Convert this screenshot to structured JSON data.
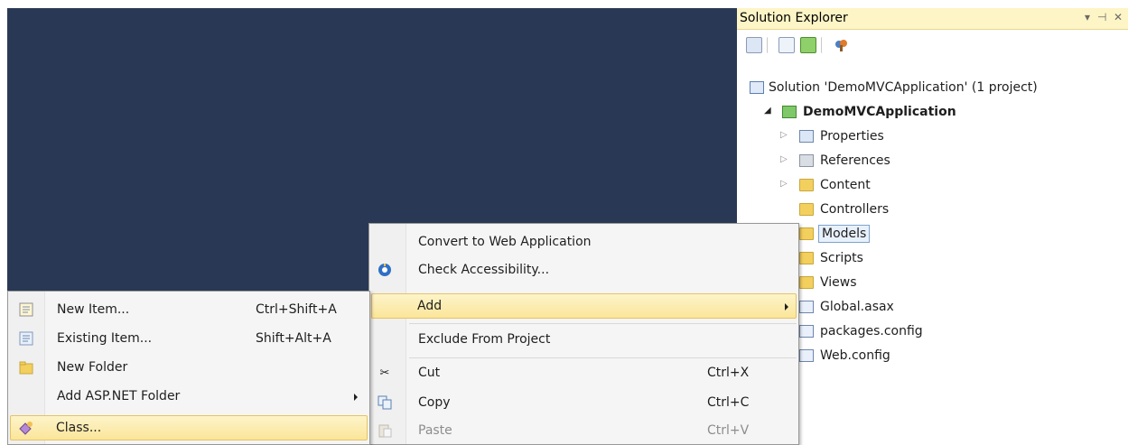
{
  "solution_explorer": {
    "title": "Solution Explorer",
    "controls": {
      "dropdown": "▾",
      "pin": "⊣",
      "close": "✕"
    },
    "tree": {
      "solution": "Solution 'DemoMVCApplication' (1 project)",
      "project": "DemoMVCApplication",
      "items": [
        "Properties",
        "References",
        "Content",
        "Controllers",
        "Models",
        "Scripts",
        "Views",
        "Global.asax",
        "packages.config",
        "Web.config"
      ]
    }
  },
  "context_menu": {
    "items": [
      {
        "label": "Convert to Web Application",
        "shortcut": ""
      },
      {
        "label": "Check Accessibility...",
        "shortcut": ""
      },
      {
        "label": "Add",
        "shortcut": ""
      },
      {
        "label": "Exclude From Project",
        "shortcut": ""
      },
      {
        "label": "Cut",
        "shortcut": "Ctrl+X"
      },
      {
        "label": "Copy",
        "shortcut": "Ctrl+C"
      },
      {
        "label": "Paste",
        "shortcut": "Ctrl+V"
      }
    ]
  },
  "add_submenu": {
    "items": [
      {
        "label": "New Item...",
        "shortcut": "Ctrl+Shift+A"
      },
      {
        "label": "Existing Item...",
        "shortcut": "Shift+Alt+A"
      },
      {
        "label": "New Folder",
        "shortcut": ""
      },
      {
        "label": "Add ASP.NET Folder",
        "shortcut": ""
      },
      {
        "label": "Class...",
        "shortcut": ""
      }
    ]
  },
  "colors": {
    "editor_background": "#293955",
    "title_bar": "#fdf5c6",
    "menu_highlight": "#fbe59a"
  }
}
